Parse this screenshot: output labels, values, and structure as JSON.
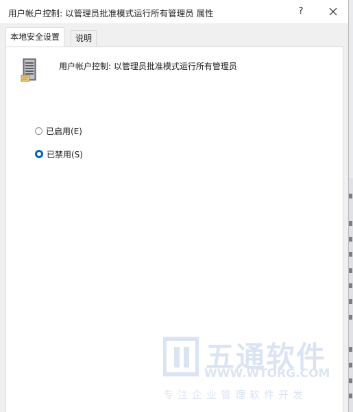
{
  "window": {
    "title": "用户帐户控制: 以管理员批准模式运行所有管理员 属性",
    "help_label": "?"
  },
  "tabs": [
    {
      "label": "本地安全设置",
      "active": true
    },
    {
      "label": "说明",
      "active": false
    }
  ],
  "policy": {
    "name": "用户帐户控制: 以管理员批准模式运行所有管理员",
    "icon": "server-icon"
  },
  "options": [
    {
      "label": "已启用(E)",
      "checked": false
    },
    {
      "label": "已禁用(S)",
      "checked": true
    }
  ],
  "watermark": {
    "brand": "五通软件",
    "url": "WWW.WTORG.COM",
    "slogan": "专注企业管理软件开发"
  },
  "colors": {
    "accent": "#0067c0",
    "watermark": "#1f5fb4"
  }
}
